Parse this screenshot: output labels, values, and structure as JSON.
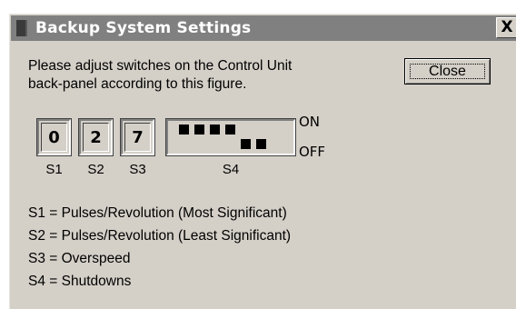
{
  "window": {
    "title": "Backup System Settings",
    "close_glyph": "X"
  },
  "instructions": {
    "line1": "Please adjust switches on the Control Unit",
    "line2": "back-panel according to this figure."
  },
  "close_button": {
    "label": "Close"
  },
  "switches": [
    {
      "label": "S1",
      "value": "0"
    },
    {
      "label": "S2",
      "value": "2"
    },
    {
      "label": "S3",
      "value": "7"
    },
    {
      "label": "S4",
      "positions": [
        "ON",
        "ON",
        "ON",
        "ON",
        "OFF",
        "OFF"
      ]
    }
  ],
  "dip_labels": {
    "on": "ON",
    "off": "OFF"
  },
  "legend": [
    "S1 = Pulses/Revolution (Most Significant)",
    "S2 = Pulses/Revolution (Least Significant)",
    "S3 = Overspeed",
    "S4 = Shutdowns"
  ]
}
